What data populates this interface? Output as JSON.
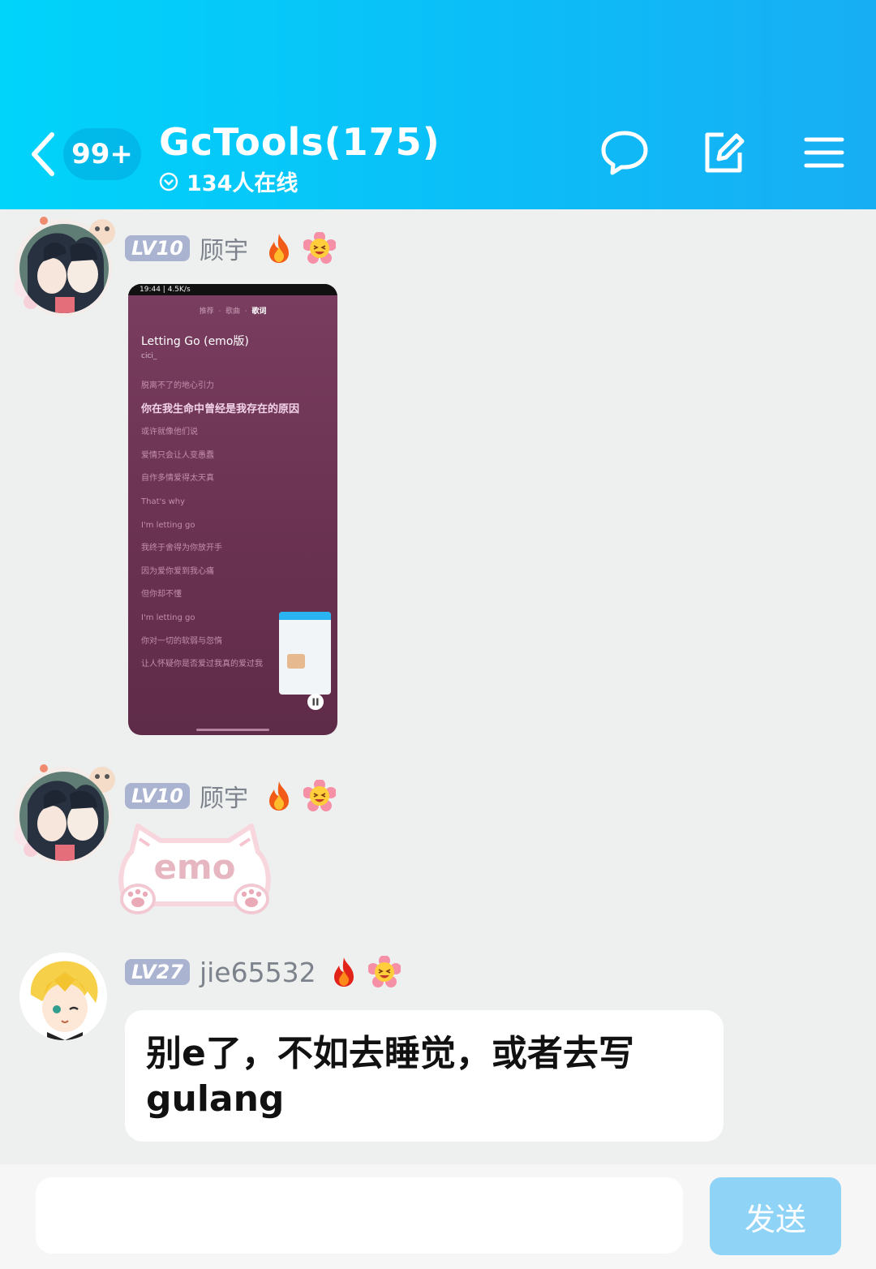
{
  "header": {
    "unread_count": "99+",
    "title": "GcTools(175)",
    "online_status": "134人在线"
  },
  "messages": [
    {
      "sender": {
        "level": "LV10",
        "nickname": "顾宇"
      },
      "type": "image",
      "image": {
        "status_time": "19:44 | 4.5K/s",
        "tabs": [
          "推荐",
          "歌曲",
          "歌词"
        ],
        "active_tab": "歌词",
        "song_title": "Letting Go (emo版)",
        "artist": "cici_",
        "lyrics": [
          "脱离不了的地心引力",
          "你在我生命中曾经是我存在的原因",
          "或许就像他们说",
          "爱情只会让人变愚蠢",
          "自作多情爱得太天真",
          "That's why",
          "I'm letting go",
          "我终于舍得为你放开手",
          "因为爱你爱到我心痛",
          "但你却不懂",
          "I'm letting go",
          "你对一切的软弱与忽惰",
          "让人怀疑你是否爱过我真的爱过我"
        ],
        "active_lyric_index": 1
      }
    },
    {
      "sender": {
        "level": "LV10",
        "nickname": "顾宇"
      },
      "type": "sticker",
      "sticker_text": "emo"
    },
    {
      "sender": {
        "level": "LV27",
        "nickname": "jie65532"
      },
      "type": "text",
      "text": "别e了，不如去睡觉，或者去写gulang"
    }
  ],
  "input": {
    "placeholder": "",
    "value": ""
  },
  "send_button": {
    "label": "发送"
  },
  "colors": {
    "header_start": "#00d4fb",
    "header_end": "#18aef4",
    "level_badge": "#aab3cf",
    "send_button": "#8fd3f7"
  }
}
